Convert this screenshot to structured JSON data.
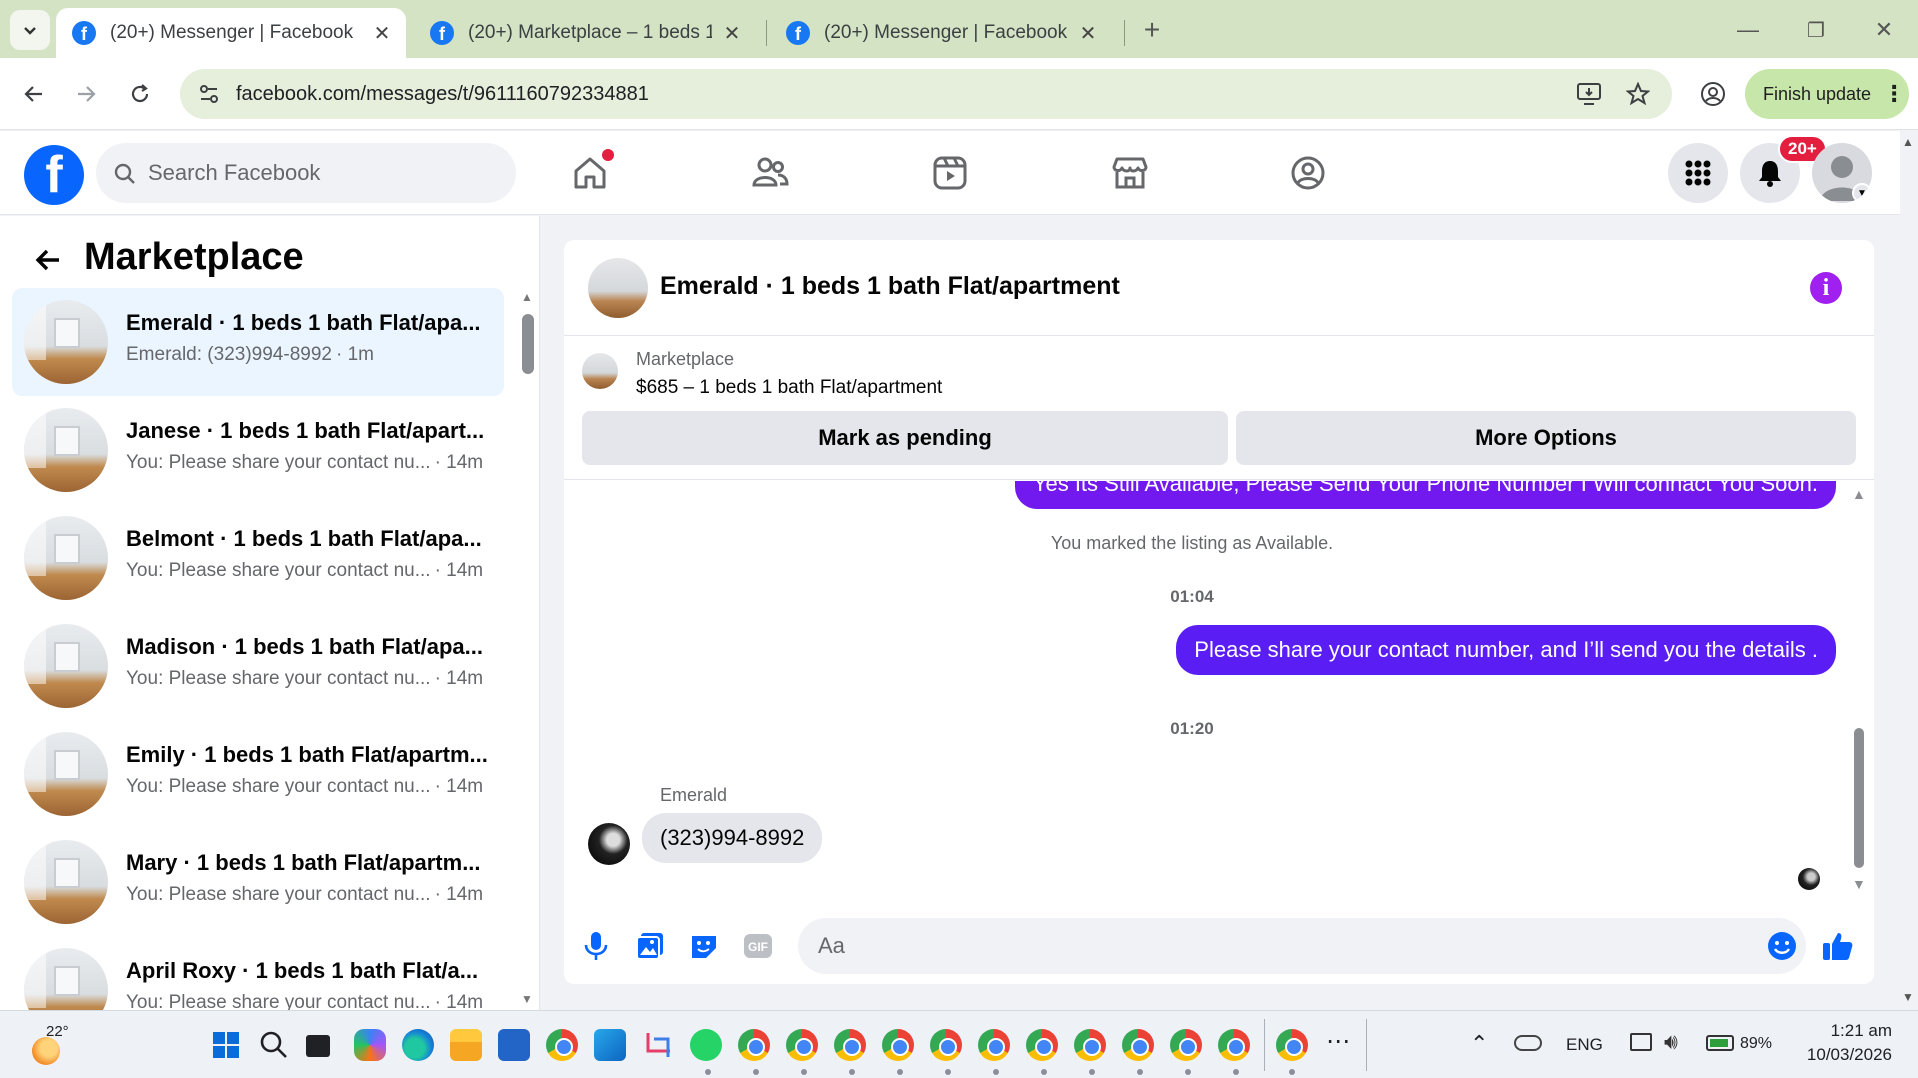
{
  "browser": {
    "tabs": [
      {
        "title": "(20+) Messenger | Facebook",
        "active": true
      },
      {
        "title": "(20+) Marketplace – 1 beds 1 b",
        "active": false
      },
      {
        "title": "(20+) Messenger | Facebook",
        "active": false
      }
    ],
    "url": "facebook.com/messages/t/9611160792334881",
    "finish_update": "Finish update"
  },
  "fb": {
    "search_placeholder": "Search Facebook",
    "notif_badge": "20+"
  },
  "left": {
    "title": "Marketplace",
    "conversations": [
      {
        "name": "Emerald · 1 beds 1 bath Flat/apa...",
        "snippet": "Emerald: (323)994-8992",
        "time": "· 1m",
        "selected": true
      },
      {
        "name": "Janese · 1 beds 1 bath Flat/apart...",
        "snippet": "You: Please share your contact nu...",
        "time": "· 14m"
      },
      {
        "name": "Belmont · 1 beds 1 bath Flat/apa...",
        "snippet": "You: Please share your contact nu...",
        "time": "· 14m"
      },
      {
        "name": "Madison · 1 beds 1 bath Flat/apa...",
        "snippet": "You: Please share your contact nu...",
        "time": "· 14m"
      },
      {
        "name": "Emily · 1 beds 1 bath Flat/apartm...",
        "snippet": "You: Please share your contact nu...",
        "time": "· 14m"
      },
      {
        "name": "Mary · 1 beds 1 bath Flat/apartm...",
        "snippet": "You: Please share your contact nu...",
        "time": "· 14m"
      },
      {
        "name": "April Roxy · 1 beds 1 bath Flat/a...",
        "snippet": "You: Please share your contact nu...",
        "time": "· 14m"
      }
    ]
  },
  "chat": {
    "title": "Emerald · 1 beds 1 bath Flat/apartment",
    "listing_label": "Marketplace",
    "listing_price": "$685 – 1 beds 1 bath Flat/apartment",
    "btn_pending": "Mark as pending",
    "btn_more": "More Options",
    "messages": {
      "out1": "Yes Its Still Available, Please Send Your Phone Number I Will connact You Soon.",
      "sys1": "You marked the listing as Available.",
      "time1": "01:04",
      "out2": "Please share your contact number, and I’ll send you the details .",
      "time2": "01:20",
      "sender": "Emerald",
      "in1": "(323)994-8992"
    },
    "composer_placeholder": "Aa"
  },
  "taskbar": {
    "weather": "22°",
    "lang": "ENG",
    "battery": "89%",
    "time": "1:21 am",
    "date": "10/03/2026"
  },
  "colors": {
    "fb_blue": "#0866ff",
    "outgoing_bubble": "#7219f0",
    "selected_conv": "#ebf5ff",
    "notif_red": "#e41e3f"
  }
}
